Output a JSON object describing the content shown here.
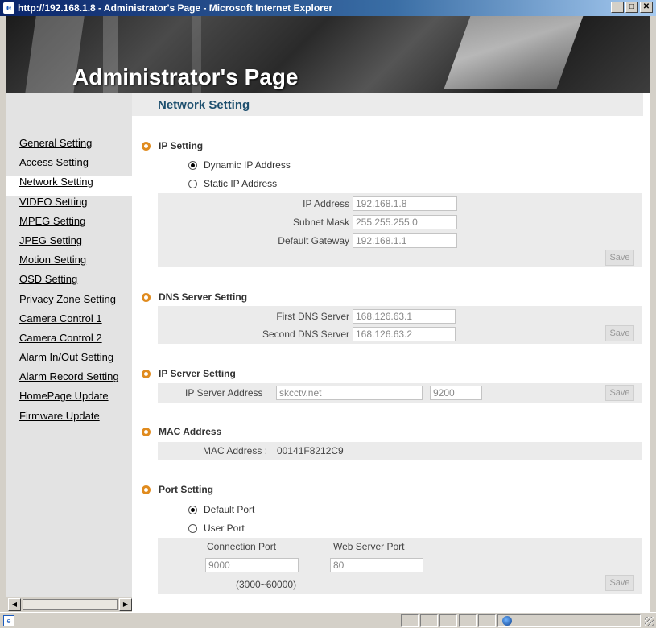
{
  "window": {
    "title": "http://192.168.1.8 - Administrator's Page - Microsoft Internet Explorer",
    "buttons": {
      "minimize": "_",
      "maximize": "□",
      "close": "✕"
    }
  },
  "banner": {
    "title": "Administrator's Page"
  },
  "sidebar": {
    "items": [
      {
        "label": "General Setting"
      },
      {
        "label": "Access Setting"
      },
      {
        "label": "Network Setting",
        "active": true
      },
      {
        "label": "VIDEO Setting"
      },
      {
        "label": "MPEG Setting"
      },
      {
        "label": "JPEG Setting"
      },
      {
        "label": "Motion Setting"
      },
      {
        "label": "OSD Setting"
      },
      {
        "label": "Privacy Zone Setting"
      },
      {
        "label": "Camera Control 1"
      },
      {
        "label": "Camera Control 2"
      },
      {
        "label": "Alarm In/Out Setting"
      },
      {
        "label": "Alarm Record Setting"
      },
      {
        "label": "HomePage Update"
      },
      {
        "label": "Firmware Update"
      }
    ]
  },
  "main": {
    "page_title": "Network Setting",
    "ip_setting": {
      "heading": "IP Setting",
      "options": [
        "Dynamic IP Address",
        "Static IP Address"
      ],
      "selected": "Dynamic IP Address",
      "ip_address": {
        "label": "IP Address",
        "value": "192.168.1.8"
      },
      "subnet_mask": {
        "label": "Subnet Mask",
        "value": "255.255.255.0"
      },
      "gateway": {
        "label": "Default Gateway",
        "value": "192.168.1.1"
      },
      "save_label": "Save"
    },
    "dns_setting": {
      "heading": "DNS Server Setting",
      "first": {
        "label": "First DNS Server",
        "value": "168.126.63.1"
      },
      "second": {
        "label": "Second DNS Server",
        "value": "168.126.63.2"
      },
      "save_label": "Save"
    },
    "ip_server": {
      "heading": "IP Server Setting",
      "label": "IP Server Address",
      "address": "skcctv.net",
      "port": "9200",
      "save_label": "Save"
    },
    "mac": {
      "heading": "MAC Address",
      "label": "MAC Address :",
      "value": "00141F8212C9"
    },
    "port_setting": {
      "heading": "Port Setting",
      "options": [
        "Default Port",
        "User Port"
      ],
      "selected": "Default Port",
      "connection_port": {
        "label": "Connection Port",
        "value": "9000"
      },
      "web_port": {
        "label": "Web Server Port",
        "value": "80"
      },
      "range_note": "(3000~60000)",
      "save_label": "Save"
    }
  },
  "colors": {
    "bullet": "#e08b1e",
    "title": "#1d4f6e",
    "panel": "#ebebeb",
    "sidebar": "#e3e3e3"
  }
}
